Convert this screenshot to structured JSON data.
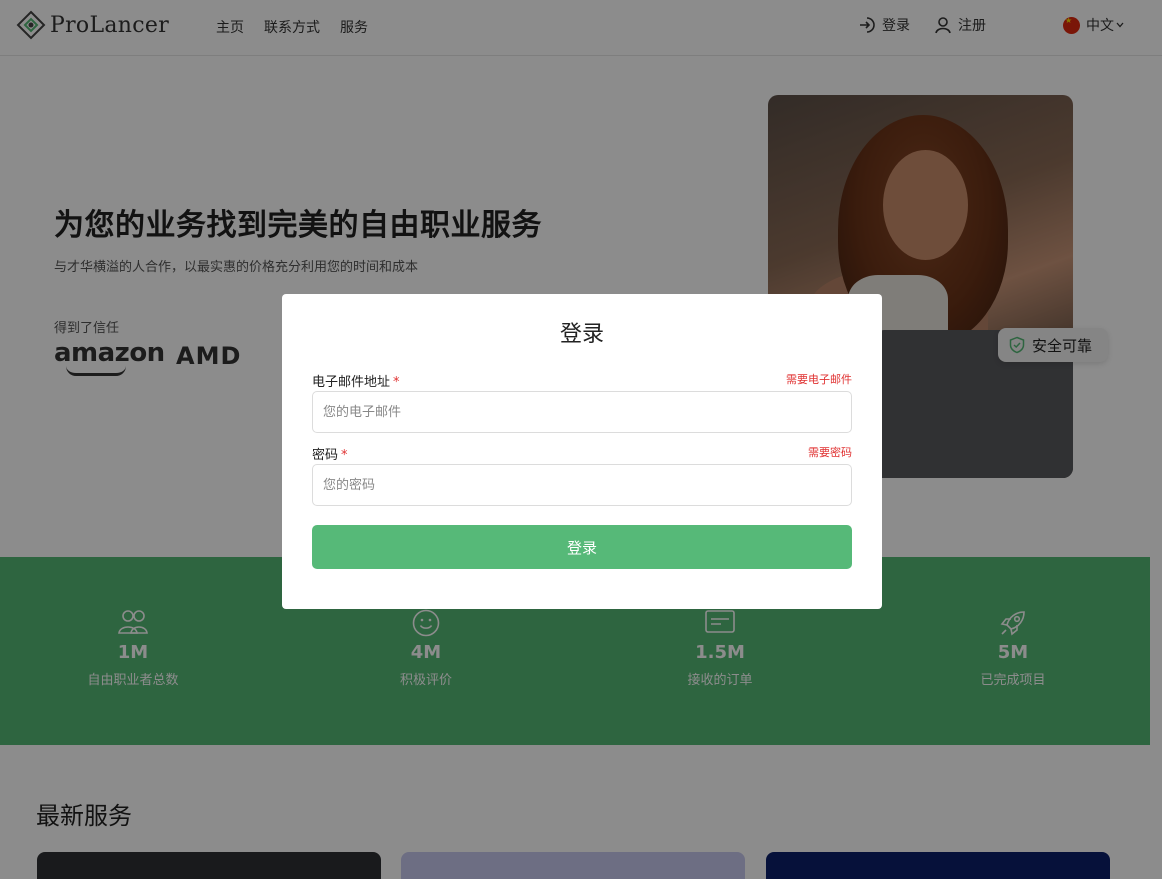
{
  "header": {
    "logo_text": "ProLancer",
    "nav": [
      "主页",
      "联系方式",
      "服务"
    ],
    "login_label": "登录",
    "register_label": "注册",
    "language_label": "中文"
  },
  "hero": {
    "title": "为您的业务找到完美的自由职业服务",
    "subtitle": "与才华横溢的人合作，以最实惠的价格充分利用您的时间和成本",
    "trusted_label": "得到了信任",
    "brands": [
      "amazon",
      "AMD"
    ],
    "badge_label": "安全可靠"
  },
  "stats": [
    {
      "icon": "users-icon",
      "value": "1M",
      "label": "自由职业者总数"
    },
    {
      "icon": "smile-icon",
      "value": "4M",
      "label": "积极评价"
    },
    {
      "icon": "order-icon",
      "value": "1.5M",
      "label": "接收的订单"
    },
    {
      "icon": "rocket-icon",
      "value": "5M",
      "label": "已完成项目"
    }
  ],
  "latest": {
    "title": "最新服务"
  },
  "modal": {
    "title": "登录",
    "email": {
      "label": "电子邮件地址",
      "required_mark": "*",
      "error": "需要电子邮件",
      "placeholder": "您的电子邮件",
      "value": ""
    },
    "password": {
      "label": "密码",
      "required_mark": "*",
      "error": "需要密码",
      "placeholder": "您的密码",
      "value": ""
    },
    "submit_label": "登录"
  },
  "colors": {
    "brand_green": "#55b976",
    "error_red": "#e03131"
  }
}
